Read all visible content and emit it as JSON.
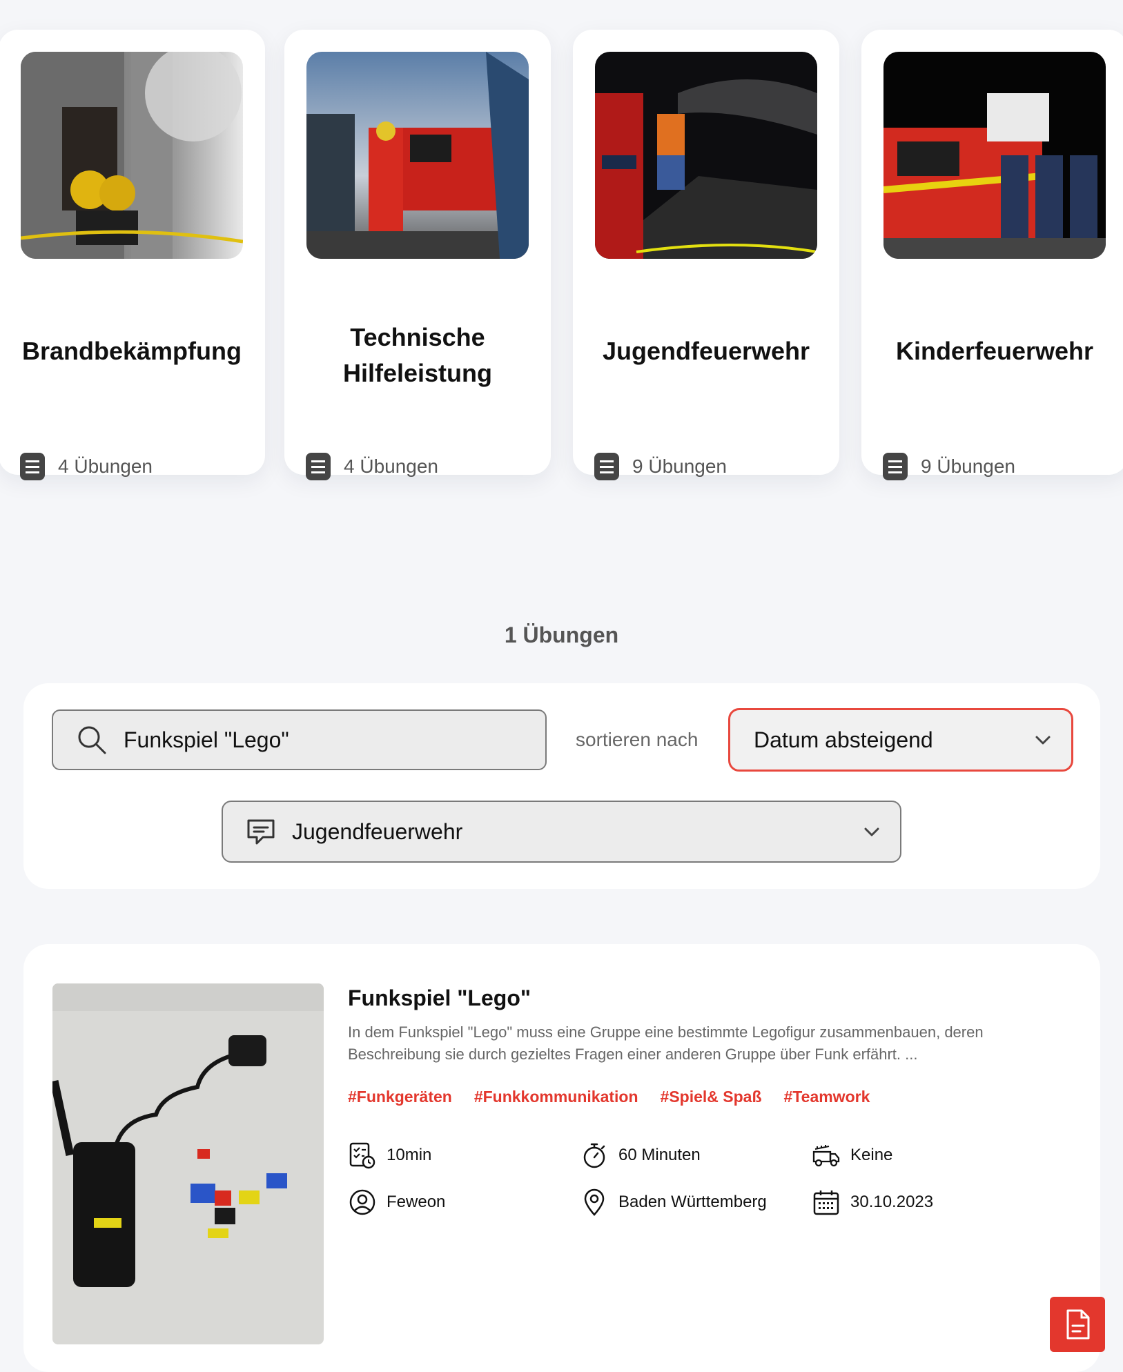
{
  "categories": [
    {
      "title": "Brandbekämpfung",
      "count": "4 Übungen"
    },
    {
      "title": "Technische Hilfeleistung",
      "count": "4 Übungen"
    },
    {
      "title": "Jugendfeuerwehr",
      "count": "9 Übungen"
    },
    {
      "title": "Kinderfeuerwehr",
      "count": "9 Übungen"
    }
  ],
  "result_count": "1 Übungen",
  "filters": {
    "search_value": "Funkspiel \"Lego\"",
    "sort_label": "sortieren nach",
    "sort_value": "Datum absteigend",
    "category_value": "Jugendfeuerwehr"
  },
  "result": {
    "title": "Funkspiel \"Lego\"",
    "description_line1": "In dem Funkspiel \"Lego\" muss eine Gruppe eine bestimmte Legofigur zusammenbauen, deren",
    "description_line2": "Beschreibung sie durch gezieltes Fragen einer anderen Gruppe über Funk erfährt. ...",
    "tags": [
      "#Funkgeräten",
      "#Funkkommunikation",
      "#Spiel& Spaß",
      "#Teamwork"
    ],
    "prep_time": "10min",
    "duration": "60 Minuten",
    "vehicle": "Keine",
    "author": "Feweon",
    "region": "Baden Württemberg",
    "date": "30.10.2023"
  },
  "colors": {
    "accent": "#e3372d",
    "page_background": "#f5f6f9"
  }
}
